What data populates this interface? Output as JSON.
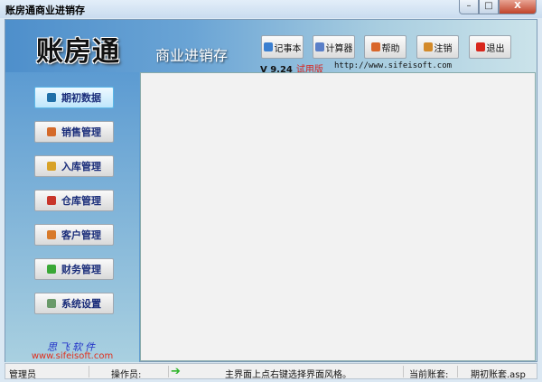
{
  "window": {
    "title": "账房通商业进销存",
    "controls": {
      "minimize": "–",
      "maximize": "□",
      "close": "X"
    }
  },
  "header": {
    "logo": "账房通",
    "subtitle": "商业进销存",
    "version": "V 9.24",
    "edition": "试用版",
    "url": "http://www.sifeisoft.com",
    "buttons": [
      {
        "label": "记事本",
        "icon": "notepad-icon",
        "color": "#3b7fd0"
      },
      {
        "label": "计算器",
        "icon": "calculator-icon",
        "color": "#5a7fc8"
      },
      {
        "label": "帮助",
        "icon": "help-icon",
        "color": "#d9662a"
      },
      {
        "label": "注销",
        "icon": "logout-users-icon",
        "color": "#d38a2a"
      },
      {
        "label": "退出",
        "icon": "power-icon",
        "color": "#d8261c"
      }
    ]
  },
  "sidebar": {
    "items": [
      {
        "label": "期初数据",
        "icon": "book-icon",
        "color": "#1f6fa8",
        "active": true
      },
      {
        "label": "销售管理",
        "icon": "sales-icon",
        "color": "#d46a2a"
      },
      {
        "label": "入库管理",
        "icon": "box-icon",
        "color": "#d8a227"
      },
      {
        "label": "仓库管理",
        "icon": "warehouse-icon",
        "color": "#c8352a"
      },
      {
        "label": "客户管理",
        "icon": "customers-icon",
        "color": "#d87a2a"
      },
      {
        "label": "财务管理",
        "icon": "finance-icon",
        "color": "#3aa836"
      },
      {
        "label": "系统设置",
        "icon": "settings-icon",
        "color": "#6a9a6a"
      }
    ]
  },
  "brand": {
    "name": "思飞软件",
    "url": "www.sifeisoft.com"
  },
  "status": {
    "user": "管理员",
    "operator_label": "操作员:",
    "message": "主界面上点右键选择界面风格。",
    "account_label": "当前账套:",
    "account": "期初账套.asp",
    "arrow_color": "#2fb52a"
  }
}
